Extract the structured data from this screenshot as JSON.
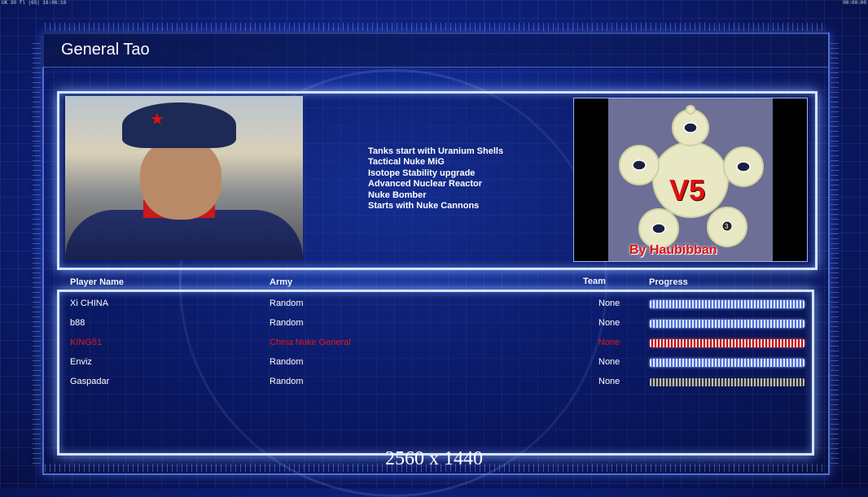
{
  "hud": {
    "left": "UK 30 fl |65| 16:06:10",
    "right": "00:00:00"
  },
  "general": {
    "name": "General Tao"
  },
  "abilities": [
    "Tanks start with Uranium Shells",
    "Tactical Nuke MiG",
    "Isotope Stability upgrade",
    "Advanced Nuclear Reactor",
    "Nuke Bomber",
    "Starts with Nuke Cannons"
  ],
  "map_logo": {
    "title": "V5",
    "credit": "By Haubibban",
    "marker": "3"
  },
  "table": {
    "headers": {
      "player": "Player Name",
      "army": "Army",
      "team": "Team",
      "progress": "Progress"
    },
    "rows": [
      {
        "name": "Xi CHINA",
        "army": "Random",
        "team": "None",
        "progress": 1.0,
        "color": "#ffffff"
      },
      {
        "name": "b88",
        "army": "Random",
        "team": "None",
        "progress": 1.0,
        "color": "#ffffff"
      },
      {
        "name": "KING51",
        "army": "China Nuke General",
        "team": "None",
        "progress": 1.0,
        "color": "#e01818"
      },
      {
        "name": "Enviz",
        "army": "Random",
        "team": "None",
        "progress": 1.0,
        "color": "#ffffff"
      },
      {
        "name": "Gaspadar",
        "army": "Random",
        "team": "None",
        "progress": 1.0,
        "color": "#999999"
      }
    ]
  },
  "resolution": "2560 x 1440"
}
